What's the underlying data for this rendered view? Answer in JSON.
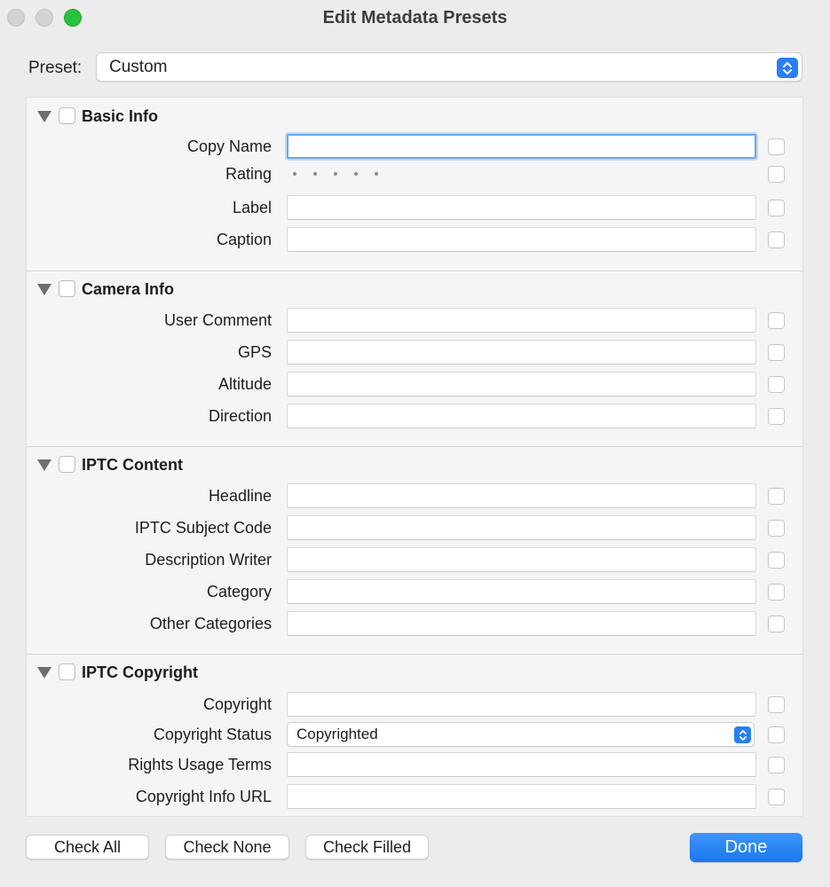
{
  "window": {
    "title": "Edit Metadata Presets"
  },
  "preset": {
    "label": "Preset:",
    "value": "Custom"
  },
  "sections": {
    "basic_info": {
      "title": "Basic Info",
      "copy_name": "Copy Name",
      "rating": "Rating",
      "label": "Label",
      "caption": "Caption"
    },
    "camera_info": {
      "title": "Camera Info",
      "user_comment": "User Comment",
      "gps": "GPS",
      "altitude": "Altitude",
      "direction": "Direction"
    },
    "iptc_content": {
      "title": "IPTC Content",
      "headline": "Headline",
      "subject_code": "IPTC Subject Code",
      "description_writer": "Description Writer",
      "category": "Category",
      "other_categories": "Other Categories"
    },
    "iptc_copyright": {
      "title": "IPTC Copyright",
      "copyright": "Copyright",
      "copyright_status": "Copyright Status",
      "copyright_status_value": "Copyrighted",
      "rights_usage_terms": "Rights Usage Terms",
      "copyright_info_url": "Copyright Info URL"
    }
  },
  "buttons": {
    "check_all": "Check All",
    "check_none": "Check None",
    "check_filled": "Check Filled",
    "done": "Done"
  },
  "colors": {
    "accent": "#2a7ff5",
    "close_button": "#d3d3d3",
    "zoom_button": "#29c23f"
  }
}
